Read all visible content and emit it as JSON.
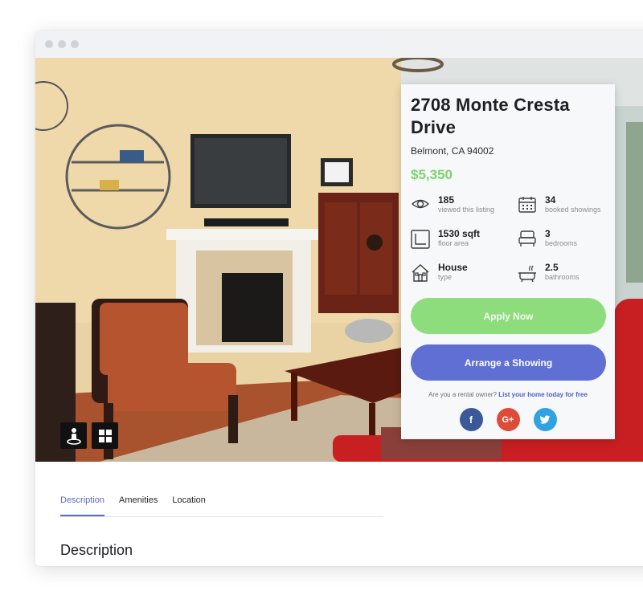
{
  "listing": {
    "title": "2708 Monte Cresta Drive",
    "address": "Belmont, CA 94002",
    "price": "$5,350"
  },
  "stats": [
    {
      "icon": "eye-icon",
      "value": "185",
      "label": "viewed this listing"
    },
    {
      "icon": "calendar-icon",
      "value": "34",
      "label": "booked showings"
    },
    {
      "icon": "floor-area-icon",
      "value": "1530 sqft",
      "label": "floor area"
    },
    {
      "icon": "bed-icon",
      "value": "3",
      "label": "bedrooms"
    },
    {
      "icon": "house-icon",
      "value": "House",
      "label": "type"
    },
    {
      "icon": "bathtub-icon",
      "value": "2.5",
      "label": "bathrooms"
    }
  ],
  "actions": {
    "apply": "Apply Now",
    "showing": "Arrange a Showing"
  },
  "owner": {
    "prompt": "Are you a rental owner?",
    "link": "List your home today for free"
  },
  "social": {
    "facebook": "f",
    "google": "G+",
    "twitter": "twitter-icon"
  },
  "tabs": [
    "Description",
    "Amenities",
    "Location"
  ],
  "section_title": "Description",
  "colors": {
    "accent": "#5f6fd3",
    "price": "#7ed26d",
    "apply": "#8ddd7c"
  }
}
